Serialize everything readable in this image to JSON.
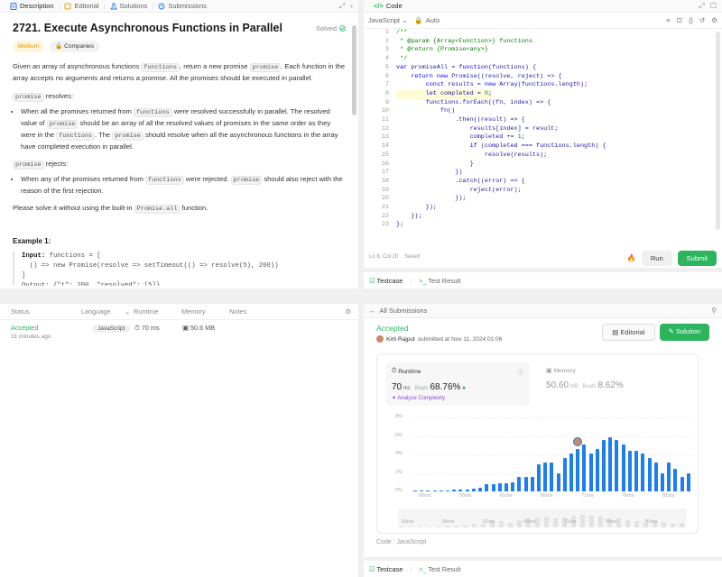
{
  "desc_tabs": [
    {
      "label": "Description",
      "active": true
    },
    {
      "label": "Editorial"
    },
    {
      "label": "Solutions"
    },
    {
      "label": "Submissions"
    }
  ],
  "problem": {
    "title": "2721. Execute Asynchronous Functions in Parallel",
    "solved": "Solved",
    "difficulty": "Medium",
    "companies": "Companies",
    "intro_a": "Given an array of asynchronous functions ",
    "intro_code": "functions",
    "intro_b": ", return a new promise ",
    "intro_code2": "promise",
    "intro_c": ". Each function in the array accepts no arguments and returns a promise. All the promises should be executed in parallel.",
    "resolves_code": "promise",
    "resolves_text": " resolves:",
    "resolve_b1": "When all the promises returned from ",
    "resolve_b1_code": "functions",
    "resolve_b1_b": " were resolved successfully in parallel. The resolved value of ",
    "resolve_b1_code2": "promise",
    "resolve_b1_c": " should be an array of all the resolved values of promises in the same order as they were in the ",
    "resolve_b1_code3": "functions",
    "resolve_b1_d": ". The ",
    "resolve_b1_code4": "promise",
    "resolve_b1_e": " should resolve when all the asynchronous functions in the array have completed execution in parallel.",
    "rejects_code": "promise",
    "rejects_text": " rejects:",
    "reject_b1": "When any of the promises returned from ",
    "reject_b1_code": "functions",
    "reject_b1_b": " were rejected. ",
    "reject_b1_code2": "promise",
    "reject_b1_c": " should also reject with the reason of the first rejection.",
    "builtin_a": "Please solve it without using the built-in ",
    "builtin_code": "Promise.all",
    "builtin_b": " function.",
    "example_title": "Example 1:",
    "example_input_label": "Input:",
    "example_input_a": " functions = [",
    "example_input_b": "  () => new Promise(resolve => setTimeout(() => resolve(5), 200))",
    "example_input_c": "]",
    "example_output_partial": "Output: {\"t\": 200, \"resolved\": [5]}"
  },
  "code_tab": {
    "label": "Code"
  },
  "editor": {
    "language": "JavaScript",
    "auto": "Auto",
    "status": "Ln 8, Col 20",
    "saved": "Saved",
    "run": "Run",
    "submit": "Submit"
  },
  "code_lines": [
    "/**",
    " * @param {Array<Function>} functions",
    " * @return {Promise<any>}",
    " */",
    "var promiseAll = function(functions) {",
    "    return new Promise((resolve, reject) => {",
    "        const results = new Array(functions.length);",
    "        let completed = 0;",
    "        functions.forEach((fn, index) => {",
    "            fn()",
    "                .then((result) => {",
    "                    results[index] = result;",
    "                    completed += 1;",
    "                    if (completed === functions.length) {",
    "                        resolve(results);",
    "                    }",
    "                })",
    "                .catch((error) => {",
    "                    reject(error);",
    "                });",
    "        });",
    "    });",
    "};"
  ],
  "testcase_tabs": {
    "testcase": "Testcase",
    "test_result": "Test Result"
  },
  "submissions_table": {
    "headers": [
      "Status",
      "Language",
      "Runtime",
      "Memory",
      "Notes"
    ],
    "rows": [
      {
        "status": "Accepted",
        "time_ago": "31 minutes ago",
        "language": "JavaScript",
        "runtime": "70 ms",
        "memory": "50.6 MB"
      }
    ]
  },
  "result": {
    "back": "All Submissions",
    "status": "Accepted",
    "user": "Kirti Rajput",
    "submitted": "submitted at Nov 11, 2024 01:06",
    "editorial": "Editorial",
    "solution": "Solution",
    "runtime_label": "Runtime",
    "runtime_value": "70",
    "runtime_unit": "ms",
    "beats_label": "Beats",
    "runtime_beats": "68.76%",
    "memory_label": "Memory",
    "memory_value": "50.60",
    "memory_unit": "MB",
    "memory_beats": "8.62%",
    "analyze": "Analyze Complexity",
    "code_label": "Code",
    "code_lang": "JavaScript"
  },
  "chart_data": {
    "type": "bar",
    "y_ticks": [
      "8%",
      "6%",
      "4%",
      "2%",
      "0%"
    ],
    "ylim": [
      0,
      8
    ],
    "x_ticks": [
      "50ms",
      "56ms",
      "61ms",
      "66ms",
      "71ms",
      "76ms",
      "81ms"
    ],
    "values": [
      0.1,
      0.1,
      0.1,
      0.1,
      0.1,
      0.1,
      0.2,
      0.2,
      0.2,
      0.3,
      0.4,
      0.8,
      0.8,
      0.9,
      0.9,
      1.0,
      1.6,
      1.6,
      1.6,
      2.9,
      3.1,
      3.1,
      2.0,
      3.6,
      4.1,
      4.6,
      5.1,
      4.1,
      4.6,
      5.6,
      5.9,
      5.6,
      5.1,
      4.4,
      4.4,
      4.1,
      3.6,
      3.1,
      2.0,
      3.1,
      2.4,
      1.6,
      2.0
    ],
    "highlight_index": 25,
    "mini_values": [
      0.2,
      0.2,
      0.3,
      0.3,
      0.4,
      0.8,
      0.9,
      1.0,
      1.6,
      1.6,
      3.0,
      3.1,
      2.0,
      3.6,
      4.1,
      4.6,
      5.1,
      4.1,
      4.6,
      5.6,
      5.9,
      5.6,
      5.1,
      4.4,
      4.1,
      3.6,
      3.1,
      2.0,
      3.1,
      2.4,
      1.6,
      2.0
    ]
  },
  "colors": {
    "accepted": "#2db55d",
    "bar": "#1e7ef0",
    "medium": "#ffb800",
    "submit_bg": "#2db55d"
  }
}
